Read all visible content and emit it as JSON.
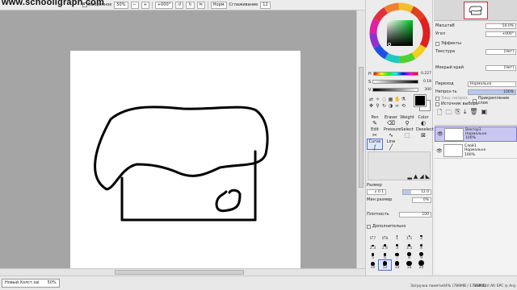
{
  "watermark": "www.schooligraph.com",
  "toolbar": {
    "selection_label": "Выбранное",
    "zoom": "50%",
    "angle": "+000°",
    "norm_label": "Норм",
    "stabilizer_label": "Сглаживание",
    "stabilizer_value": "12"
  },
  "color": {
    "h_label": "H",
    "h_value": "0.227",
    "s_label": "S",
    "s_value": "0.18",
    "v_label": "V",
    "v_value": "300"
  },
  "tools": [
    {
      "label": "Pen",
      "glyph": "✎"
    },
    {
      "label": "Eraser",
      "glyph": "⌫"
    },
    {
      "label": "Weight",
      "glyph": "⚲"
    },
    {
      "label": "Color",
      "glyph": "◐"
    },
    {
      "label": "Edit",
      "glyph": "✂"
    },
    {
      "label": "Pressure",
      "glyph": "∿"
    },
    {
      "label": "Select",
      "glyph": "⬚"
    },
    {
      "label": "Deselect",
      "glyph": "⊠"
    },
    {
      "label": "Curve",
      "glyph": "∫"
    },
    {
      "label": "Line",
      "glyph": "╱"
    },
    {
      "label": "",
      "glyph": ""
    },
    {
      "label": "",
      "glyph": ""
    }
  ],
  "brush": {
    "size_label": "Размер",
    "size_mult": "x 0.1",
    "size_value": "12.0",
    "min_size_label": "Мин размер",
    "min_size_value": "0%",
    "density_label": "Плотность",
    "density_value": "100",
    "advanced_label": "Дополнительно",
    "dot_sizes": [
      "0.7",
      "0.8",
      "1",
      "1.5",
      "2",
      "2.3",
      "2.6",
      "3",
      "3.5",
      "4",
      "5",
      "6",
      "7",
      "8",
      "9",
      "10",
      "12",
      "14",
      "16",
      "20"
    ]
  },
  "navigator": {
    "scale_label": "Масштаб",
    "scale_value": "50.0%",
    "angle_label": "Угол",
    "angle_value": "+000°"
  },
  "effects": {
    "title": "Эффекты",
    "texture_label": "Текстура",
    "texture_value": "[Нет]",
    "wet_label": "Мокрый край",
    "wet_value": "[Нет]"
  },
  "layer_props": {
    "mode_label": "Переход",
    "mode_value": "Нормально",
    "opacity_label": "Непроз-ть",
    "opacity_value": "100%",
    "clip_label": "Прикрепление слоя",
    "protect_label": "Защ. непроз.",
    "source_label": "Источник выбора"
  },
  "layers": [
    {
      "name": "Вектор1",
      "mode": "Нормально",
      "opacity": "100%",
      "selected": true
    },
    {
      "name": "Слой1",
      "mode": "Нормально",
      "opacity": "100%",
      "selected": false
    }
  ],
  "status": {
    "document_name": "Новый Холст.sai",
    "document_zoom": "50%",
    "memory": "Загрузка памяти44% (789MB / 1719MB)",
    "keys": "Shift Ctrl Alt SPC ◎ Any"
  }
}
